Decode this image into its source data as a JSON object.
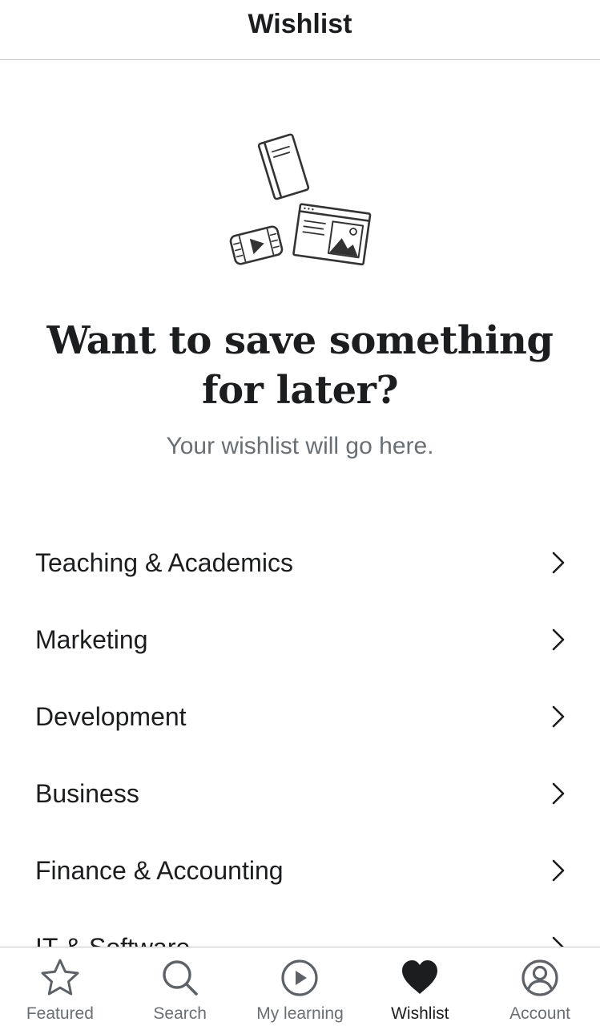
{
  "header": {
    "title": "Wishlist"
  },
  "empty_state": {
    "illustration_icon": "book-video-webpage-illustration",
    "title_line1": "Want to save something",
    "title_line2": "for later?",
    "subtitle": "Your wishlist will go here."
  },
  "categories": [
    {
      "label": "Teaching & Academics"
    },
    {
      "label": "Marketing"
    },
    {
      "label": "Development"
    },
    {
      "label": "Business"
    },
    {
      "label": "Finance & Accounting"
    },
    {
      "label": "IT & Software"
    }
  ],
  "tabbar": {
    "active_tab": "Wishlist",
    "tabs": [
      {
        "label": "Featured",
        "icon": "star-icon"
      },
      {
        "label": "Search",
        "icon": "search-icon"
      },
      {
        "label": "My learning",
        "icon": "play-circle-icon"
      },
      {
        "label": "Wishlist",
        "icon": "heart-icon"
      },
      {
        "label": "Account",
        "icon": "account-icon"
      }
    ]
  },
  "colors": {
    "text": "#1c1d1f",
    "muted": "#6a6f73",
    "divider": "#c9c9c9"
  }
}
